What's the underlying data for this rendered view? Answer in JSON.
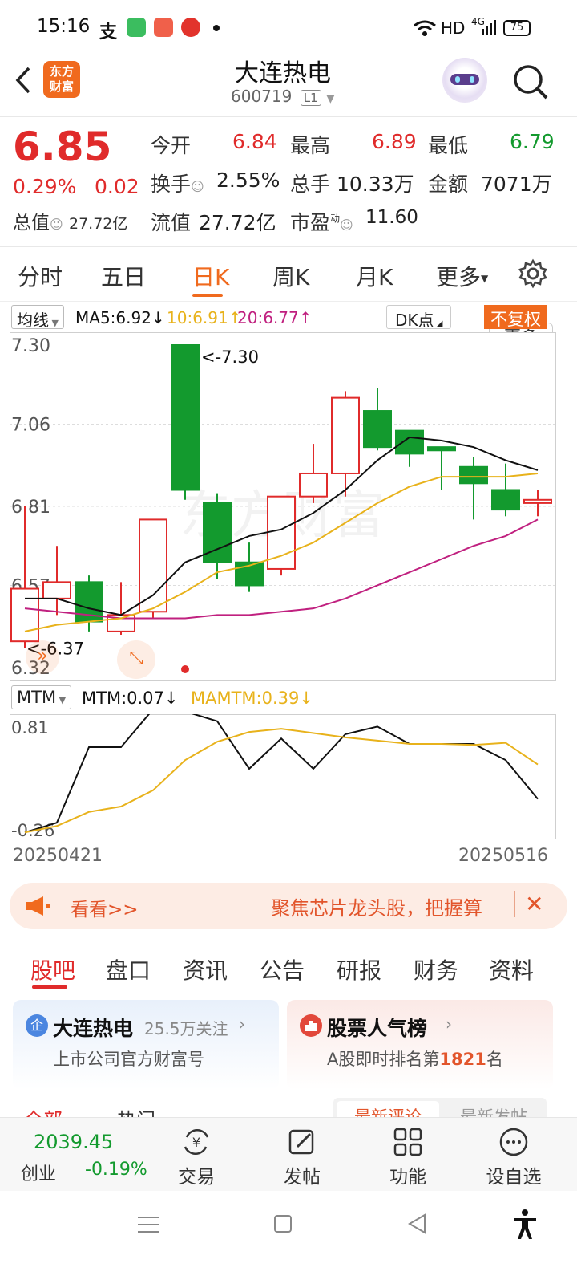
{
  "status": {
    "time": "15:16",
    "network": "HD",
    "signal_label": "4G",
    "battery": "75"
  },
  "header": {
    "brand_line1": "东方",
    "brand_line2": "财富",
    "stock_name": "大连热电",
    "stock_code": "600719",
    "level": "L1"
  },
  "quote": {
    "price": "6.85",
    "change_pct": "0.29%",
    "change_abs": "0.02",
    "market_cap_label": "总值",
    "market_cap": "27.72亿",
    "open_label": "今开",
    "open": "6.84",
    "high_label": "最高",
    "high": "6.89",
    "low_label": "最低",
    "low": "6.79",
    "turnover_label": "换手",
    "turnover": "2.55%",
    "volume_label": "总手",
    "volume": "10.33万",
    "amount_label": "金额",
    "amount": "7071万",
    "float_label": "流值",
    "float_cap": "27.72亿",
    "pe_label": "市盈",
    "pe_sup": "动",
    "pe": "11.60",
    "more_button": "更多"
  },
  "period_tabs": [
    "分时",
    "五日",
    "日K",
    "周K",
    "月K",
    "更多"
  ],
  "active_period": "日K",
  "ma_bar": {
    "selector": "均线",
    "ma5": "MA5:6.92↓",
    "ma10": "10:6.91↑",
    "ma20": "20:6.77↑",
    "dk_button": "DK点",
    "adjust_button": "不复权"
  },
  "colors": {
    "up": "#e02b2b",
    "down": "#139a2e",
    "ma5": "#111111",
    "ma10": "#e8b21b",
    "ma20": "#c0207f",
    "accent": "#f06a1e"
  },
  "chart_data": [
    {
      "type": "candlestick",
      "ylim": [
        6.32,
        7.3
      ],
      "y_ticks": [
        "7.30",
        "7.06",
        "6.81",
        "6.57",
        "6.32"
      ],
      "max_marker": "<-7.30",
      "min_marker": "<-6.37",
      "candles": [
        {
          "o": 6.4,
          "c": 6.56,
          "h": 6.81,
          "l": 6.38
        },
        {
          "o": 6.53,
          "c": 6.58,
          "h": 6.69,
          "l": 6.48
        },
        {
          "o": 6.58,
          "c": 6.46,
          "h": 6.6,
          "l": 6.43
        },
        {
          "o": 6.43,
          "c": 6.48,
          "h": 6.58,
          "l": 6.42
        },
        {
          "o": 6.49,
          "c": 6.77,
          "h": 6.77,
          "l": 6.47
        },
        {
          "o": 7.3,
          "c": 6.86,
          "h": 7.3,
          "l": 6.83
        },
        {
          "o": 6.82,
          "c": 6.64,
          "h": 6.85,
          "l": 6.59
        },
        {
          "o": 6.64,
          "c": 6.57,
          "h": 6.7,
          "l": 6.55
        },
        {
          "o": 6.62,
          "c": 6.84,
          "h": 6.84,
          "l": 6.6
        },
        {
          "o": 6.84,
          "c": 6.91,
          "h": 7.0,
          "l": 6.82
        },
        {
          "o": 6.91,
          "c": 7.14,
          "h": 7.16,
          "l": 6.84
        },
        {
          "o": 7.1,
          "c": 6.99,
          "h": 7.17,
          "l": 6.98
        },
        {
          "o": 7.04,
          "c": 6.97,
          "h": 7.04,
          "l": 6.93
        },
        {
          "o": 6.99,
          "c": 6.98,
          "h": 6.99,
          "l": 6.86
        },
        {
          "o": 6.93,
          "c": 6.88,
          "h": 6.96,
          "l": 6.77
        },
        {
          "o": 6.86,
          "c": 6.8,
          "h": 6.94,
          "l": 6.78
        },
        {
          "o": 6.82,
          "c": 6.83,
          "h": 6.86,
          "l": 6.78
        }
      ],
      "ma5": [
        6.53,
        6.53,
        6.5,
        6.48,
        6.54,
        6.64,
        6.68,
        6.72,
        6.74,
        6.79,
        6.86,
        6.95,
        7.02,
        7.01,
        6.99,
        6.95,
        6.92
      ],
      "ma10": [
        6.43,
        6.45,
        6.46,
        6.47,
        6.5,
        6.55,
        6.61,
        6.63,
        6.66,
        6.7,
        6.76,
        6.82,
        6.87,
        6.9,
        6.9,
        6.9,
        6.91
      ],
      "ma20": [
        6.5,
        6.49,
        6.48,
        6.47,
        6.47,
        6.47,
        6.48,
        6.48,
        6.49,
        6.5,
        6.53,
        6.57,
        6.61,
        6.65,
        6.69,
        6.72,
        6.77
      ],
      "mark_red_dot_index": 5
    },
    {
      "type": "line",
      "title": "MTM",
      "mtm_label": "MTM:0.07↓",
      "mamtm_label": "MAMTM:0.39↓",
      "ylim": [
        -0.26,
        0.81
      ],
      "y_ticks": [
        "0.81",
        "-0.26"
      ],
      "x_start": "20250421",
      "x_end": "20250516",
      "series": [
        {
          "name": "MTM",
          "values": [
            -0.24,
            -0.15,
            0.55,
            0.55,
            0.9,
            0.88,
            0.79,
            0.35,
            0.63,
            0.35,
            0.67,
            0.74,
            0.58,
            0.58,
            0.58,
            0.43,
            0.07
          ]
        },
        {
          "name": "MAMTM",
          "values": [
            -0.24,
            -0.18,
            -0.05,
            0.0,
            0.15,
            0.43,
            0.6,
            0.69,
            0.72,
            0.68,
            0.64,
            0.61,
            0.58,
            0.58,
            0.57,
            0.59,
            0.39
          ]
        }
      ]
    }
  ],
  "banner": {
    "left_text": "看看>>",
    "right_text": "聚焦芯片龙头股，把握算"
  },
  "section_tabs": [
    "股吧",
    "盘口",
    "资讯",
    "公告",
    "研报",
    "财务",
    "资料"
  ],
  "active_section": "股吧",
  "card_company": {
    "badge": "企",
    "name": "大连热电",
    "followers": "25.5万关注",
    "sub": "上市公司官方财富号"
  },
  "card_rank": {
    "title": "股票人气榜",
    "sub_prefix": "A股即时排名第",
    "rank": "1821",
    "sub_suffix": "名"
  },
  "subtabs_partial": {
    "left1": "全部",
    "left2": "热门",
    "right1": "最新评论",
    "right2": "最新发帖"
  },
  "bottom_nav": {
    "index_value": "2039.45",
    "index_name": "创业",
    "index_change": "-0.19%",
    "trade": "交易",
    "post": "发帖",
    "functions": "功能",
    "watchlist": "设自选"
  }
}
